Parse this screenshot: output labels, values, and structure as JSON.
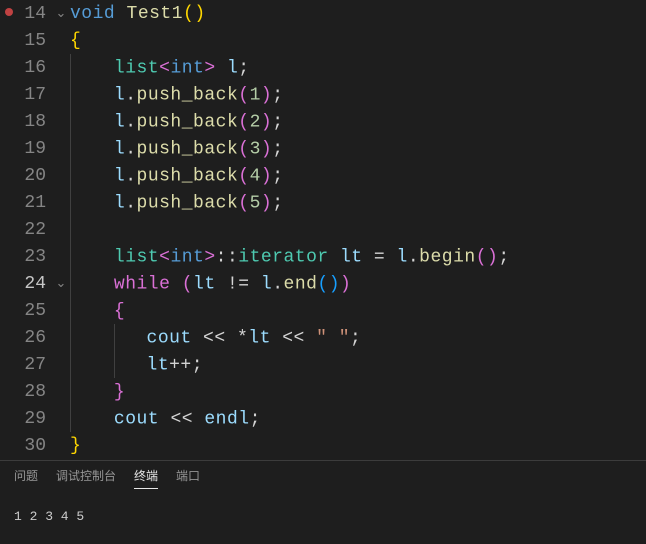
{
  "lines": {
    "l14_num": "14",
    "l15_num": "15",
    "l16_num": "16",
    "l17_num": "17",
    "l18_num": "18",
    "l19_num": "19",
    "l20_num": "20",
    "l21_num": "21",
    "l22_num": "22",
    "l23_num": "23",
    "l24_num": "24",
    "l25_num": "25",
    "l26_num": "26",
    "l27_num": "27",
    "l28_num": "28",
    "l29_num": "29",
    "l30_num": "30"
  },
  "code": {
    "kw_void": "void",
    "fn_test1": "Test1",
    "brace_open": "{",
    "brace_close": "}",
    "type_list": "list",
    "lt": "<",
    "gt": ">",
    "kw_int": "int",
    "var_l": "l",
    "semi": ";",
    "fn_push_back": "push_back",
    "lpar": "(",
    "rpar": ")",
    "n1": "1",
    "n2": "2",
    "n3": "3",
    "n4": "4",
    "n5": "5",
    "colon2": "::",
    "type_iterator": "iterator",
    "var_lt": "lt",
    "eq": "=",
    "fn_begin": "begin",
    "kw_while": "while",
    "neq": "!=",
    "fn_end": "end",
    "var_cout": "cout",
    "var_endl": "endl",
    "op_ll": "<<",
    "star": "*",
    "str_space": "\" \"",
    "pp": "++",
    "dot": "."
  },
  "panel": {
    "tabs": {
      "problems": "问题",
      "debug": "调试控制台",
      "terminal": "终端",
      "ports": "端口"
    },
    "output": "1 2 3 4 5"
  }
}
